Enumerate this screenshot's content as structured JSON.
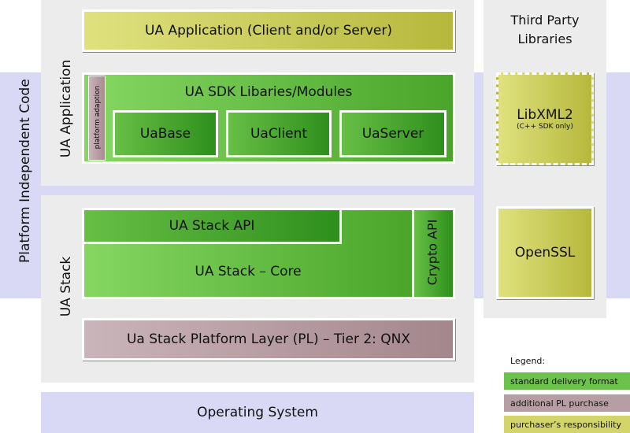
{
  "side_label": "Platform Independent Code",
  "ua_application_label": "UA Application",
  "ua_stack_label": "UA Stack",
  "ua_app_box": "UA Application (Client and/or Server)",
  "sdk": {
    "title": "UA SDK Libaries/Modules",
    "platform_adaption": "platform adaption",
    "modules": [
      "UaBase",
      "UaClient",
      "UaServer"
    ]
  },
  "stack": {
    "api": "UA Stack API",
    "core": "UA Stack – Core",
    "crypto": "Crypto API"
  },
  "platform_layer": "Ua Stack Platform Layer (PL) – Tier 2: QNX",
  "operating_system": "Operating System",
  "third_party": {
    "title_line1": "Third Party",
    "title_line2": "Libraries",
    "libxml": "LibXML2",
    "libxml_note": "(C++ SDK only)",
    "openssl": "OpenSSL"
  },
  "legend": {
    "title": "Legend:",
    "items": [
      {
        "label": "standard delivery format",
        "color": "#6cc24a"
      },
      {
        "label": "additional PL purchase",
        "color": "#b79ea4"
      },
      {
        "label": "purchaser’s responsibility",
        "color": "#d3d56a"
      }
    ]
  }
}
